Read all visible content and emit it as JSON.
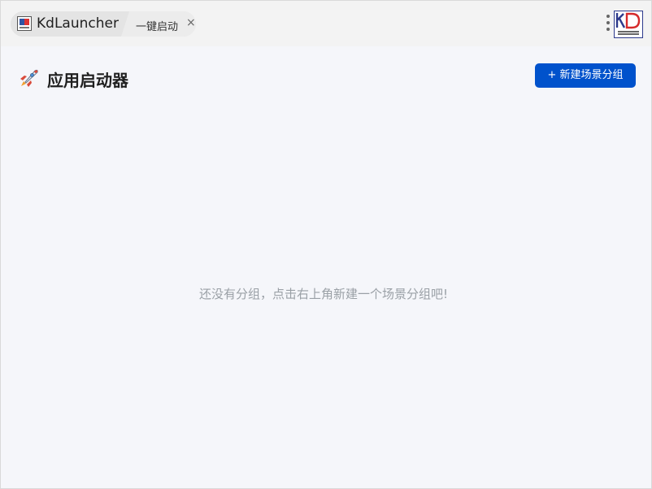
{
  "titlebar": {
    "app_name": "KdLauncher",
    "tab_label": "一键启动",
    "close_symbol": "×"
  },
  "header": {
    "title": "应用启动器",
    "new_group_button": "+ 新建场景分组"
  },
  "main": {
    "empty_message": "还没有分组，点击右上角新建一个场景分组吧!"
  },
  "colors": {
    "accent": "#0052cc",
    "background": "#f5f6fa"
  }
}
